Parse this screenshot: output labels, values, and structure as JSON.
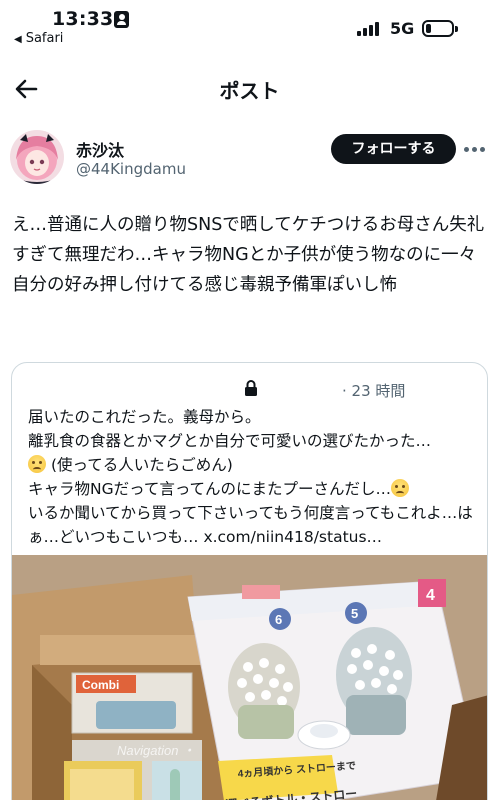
{
  "status_bar": {
    "time": "13:33",
    "back_app_label": "Safari",
    "network": "5G",
    "battery_level": 0.2
  },
  "header": {
    "title": "ポスト"
  },
  "author": {
    "display_name": "赤沙汰",
    "handle": "@44Kingdamu",
    "follow_label": "フォローする"
  },
  "post": {
    "text": "え…普通に人の贈り物SNSで晒してケチつけるお母さん失礼すぎて無理だわ…キャラ物NGとか子供が使う物なのに一々自分の好み押し付けてる感じ毒親予備軍ぽいし怖"
  },
  "quote": {
    "time": "· 23 時間",
    "line1": "届いたのこれだった。義母から。",
    "line2a": "離乳食の食器とかマグとか自分で可愛いの選びたかった…",
    "line2b": "(使ってる人いたらごめん)",
    "line3a": "キャラ物NGだって言ってんのにまたプーさんだし…",
    "line4": "いるか聞いてから買って下さいってもう何度言ってもこれよ…はぁ…どいつもこいつも… ",
    "link": "x.com/niin418/status…",
    "photo": {
      "brand": "Combi",
      "box_headline": "4ヵ月頃から ストローまで",
      "box_banner": "選べるボトル・ストロー",
      "box_number_left": "6",
      "box_number_mid": "5",
      "box_number_right": "4",
      "watermark": "Navigation ・"
    }
  },
  "colors": {
    "text": "#0f1419",
    "secondary": "#536471",
    "border": "#cfd9de",
    "follow_bg": "#0f1419"
  },
  "icons": [
    "id-card-icon",
    "back-triangle-icon",
    "signal-icon",
    "battery-icon",
    "back-arrow-icon",
    "more-icon",
    "lock-icon",
    "sad-emoji-icon"
  ]
}
